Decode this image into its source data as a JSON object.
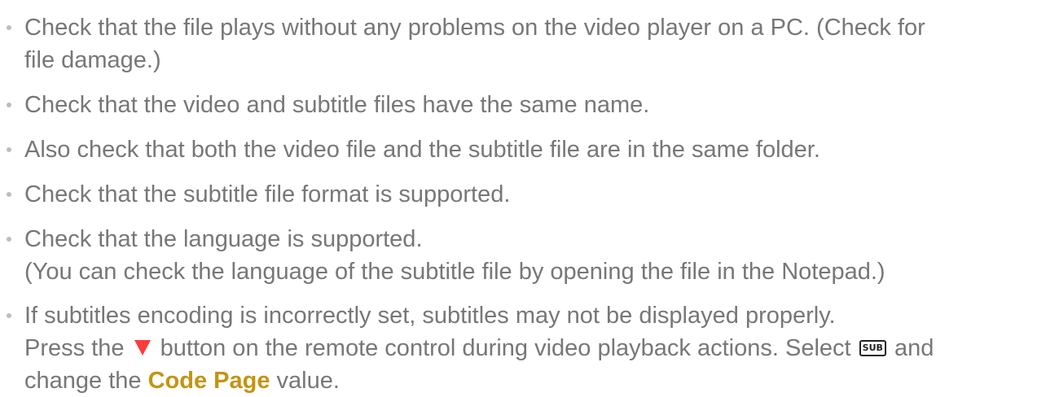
{
  "items": [
    {
      "lines": [
        "Check that the file plays without any problems on the video player on a PC. (Check for",
        "file damage.)"
      ]
    },
    {
      "lines": [
        "Check that the video and subtitle files have the same name."
      ]
    },
    {
      "lines": [
        "Also check that both the video file and the subtitle file are in the same folder."
      ]
    },
    {
      "lines": [
        "Check that the subtitle file format is supported."
      ]
    },
    {
      "lines": [
        "Check that the language is supported.",
        "(You can check the language of the subtitle file by opening the file in the Notepad.)"
      ]
    },
    {
      "line1": "If subtitles encoding is incorrectly set, subtitles may not be displayed properly.",
      "line2_a": "Press the",
      "line2_b": "button on the remote control during video playback actions. Select",
      "sub_icon_label": "SUB",
      "line2_c": "and",
      "line3_a": "change the",
      "line3_highlight": "Code Page",
      "line3_b": "value."
    }
  ],
  "icons": {
    "red_triangle": "down-triangle-icon",
    "sub": "sub-icon"
  },
  "colors": {
    "text": "#777777",
    "highlight": "#c49412",
    "triangle": "#ff3b3b"
  }
}
